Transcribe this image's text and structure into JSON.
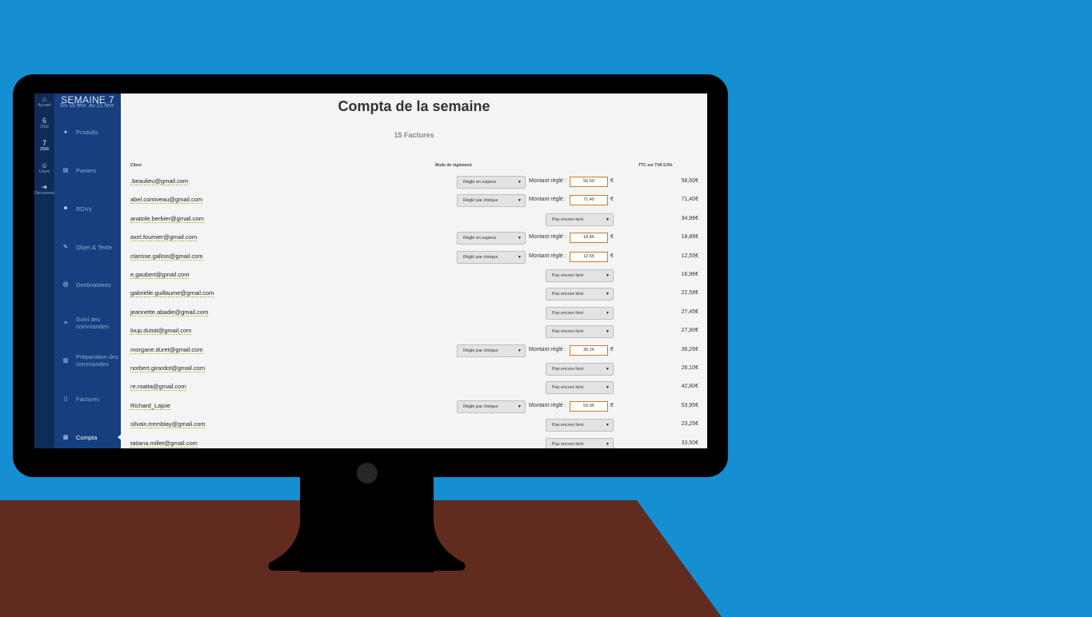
{
  "rail": {
    "items": [
      {
        "icon": "home-icon",
        "glyph": "⌂",
        "label": "Accueil"
      },
      {
        "num": "6",
        "year": "2016"
      },
      {
        "num": "7",
        "year": "2016"
      },
      {
        "icon": "users-icon",
        "glyph": "☺",
        "label": "Users"
      },
      {
        "icon": "logout-icon",
        "glyph": "➜",
        "label": "Déconnexion"
      }
    ]
  },
  "week": {
    "title": "SEMAINE 7",
    "range": "Du 15 févr. au 21 févr."
  },
  "menu": [
    {
      "label": "Produits",
      "icon": "apple-icon",
      "glyph": "●"
    },
    {
      "label": "Paniers",
      "icon": "basket-icon",
      "glyph": "▤"
    },
    {
      "label": "RDVs",
      "icon": "map-pin-icon",
      "glyph": "⬥"
    },
    {
      "label": "Objet & Texte",
      "icon": "pencil-icon",
      "glyph": "✎"
    },
    {
      "label": "Destinataires",
      "icon": "at-icon",
      "glyph": "@"
    },
    {
      "label": "Suivi des commandes",
      "icon": "list-icon",
      "glyph": "≡"
    },
    {
      "label": "Préparation des commandes",
      "icon": "map-icon",
      "glyph": "▥"
    },
    {
      "label": "Factures",
      "icon": "file-icon",
      "glyph": "▯"
    },
    {
      "label": "Compta",
      "icon": "calculator-icon",
      "glyph": "▦"
    }
  ],
  "page": {
    "title": "Compta de la semaine",
    "count": "15 Factures",
    "col_client": "Client",
    "col_mode": "Mode de règlement",
    "col_ttc": "TTC sur TVA 5.5%",
    "montant_label": "Montant réglé :",
    "euro": "€"
  },
  "rows": [
    {
      "email": ".beaulieu@gmail.com",
      "mode": "Réglé en espèce",
      "amount": "56.60",
      "ttc": "56,60€"
    },
    {
      "email": "abel.comiveau@gmail.com",
      "mode": "Réglé par chèque",
      "amount": "71.40",
      "ttc": "71,40€"
    },
    {
      "email": "anatole.berbier@gmail.com",
      "status": "Pas encore livré",
      "ttc": "34,96€"
    },
    {
      "email": "axel.fournier@gmail.com",
      "mode": "Réglé en espèce",
      "amount": "18.86",
      "ttc": "18,86€"
    },
    {
      "email": "clarisse.gallois@gmail.com",
      "mode": "Réglé par chèque",
      "amount": "12.55",
      "ttc": "12,55€"
    },
    {
      "email": "e.gaubert@gmail.com",
      "status": "Pas encore livré",
      "ttc": "16,96€"
    },
    {
      "email": "gabrielle.guillaume@gmail.com",
      "status": "Pas encore livré",
      "ttc": "22,56€"
    },
    {
      "email": "jeannette.abadie@gmail.com",
      "status": "Pas encore livré",
      "ttc": "27,45€"
    },
    {
      "email": "loup.dutoit@gmail.com",
      "status": "Pas encore livré",
      "ttc": "27,90€"
    },
    {
      "email": "morgane.duret@gmail.com",
      "mode": "Réglé par chèque",
      "amount": "36.26",
      "ttc": "36,26€"
    },
    {
      "email": "norbert.girardot@gmail.com",
      "status": "Pas encore livré",
      "ttc": "26,10€"
    },
    {
      "email": "re.roatta@gmail.com",
      "status": "Pas encore livré",
      "ttc": "42,80€"
    },
    {
      "email": "Richard_Lajoie",
      "mode": "Réglé par chèque",
      "amount": "53.95",
      "ttc": "53,95€"
    },
    {
      "email": "silvain.tremblay@gmail.com",
      "status": "Pas encore livré",
      "ttc": "23,25€"
    },
    {
      "email": "tatiana.millet@gmail.com",
      "status": "Pas encore livré",
      "ttc": "33,50€"
    }
  ],
  "colors": {
    "background": "#168ed2",
    "desk": "#612b1f",
    "rail": "#0f2c58",
    "menu": "#173f7f",
    "amount_border": "#d07a1c"
  }
}
